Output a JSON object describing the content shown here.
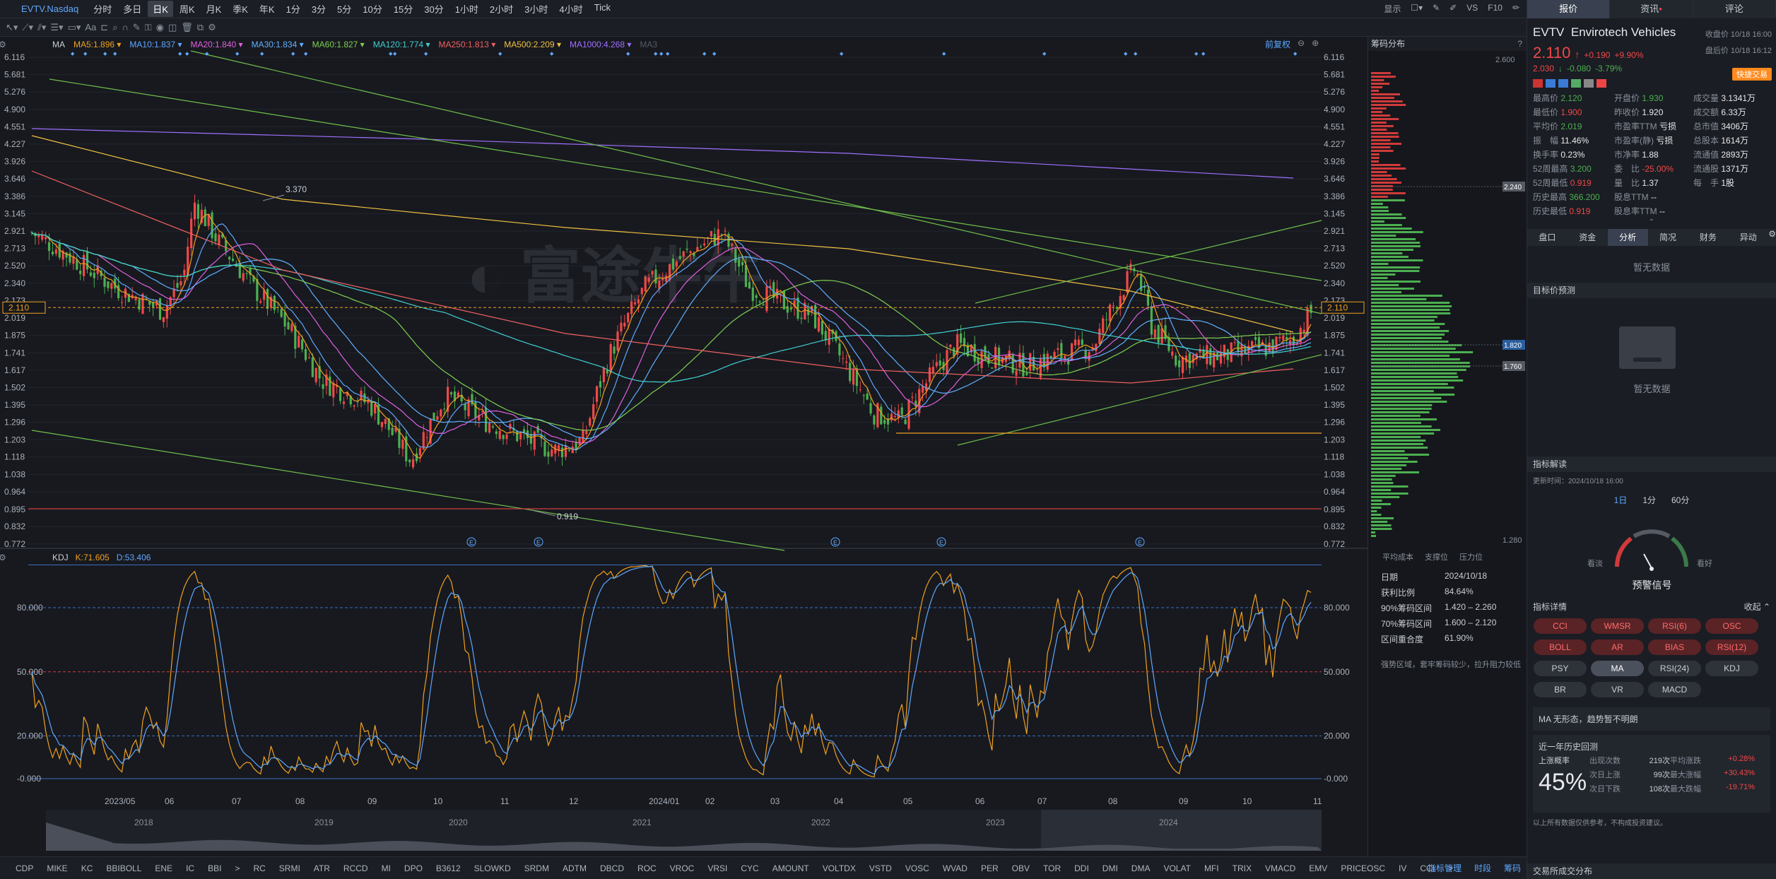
{
  "toolbar": {
    "symbol": "EVTV.Nasdaq",
    "timeframes": [
      "分时",
      "多日",
      "日K",
      "周K",
      "月K",
      "季K",
      "年K",
      "1分",
      "3分",
      "5分",
      "10分",
      "15分",
      "30分",
      "1小时",
      "2小时",
      "3小时",
      "4小时",
      "Tick"
    ],
    "active_timeframe": "日K",
    "right_items": [
      "显示",
      "VS",
      "F10"
    ]
  },
  "ma_legend": {
    "name": "MA",
    "items": [
      {
        "label": "MA5:1.896",
        "color": "#f0a020"
      },
      {
        "label": "MA10:1.837",
        "color": "#5fa8ff"
      },
      {
        "label": "MA20:1.840",
        "color": "#e060e0"
      },
      {
        "label": "MA30:1.834",
        "color": "#60b0ff"
      },
      {
        "label": "MA60:1.827",
        "color": "#7fd050"
      },
      {
        "label": "MA120:1.774",
        "color": "#40d0d0"
      },
      {
        "label": "MA250:1.813",
        "color": "#f06060"
      },
      {
        "label": "MA500:2.209",
        "color": "#f0c040"
      },
      {
        "label": "MA1000:4.268",
        "color": "#a070ff"
      },
      {
        "label": "MA3",
        "color": "#555a63"
      }
    ],
    "adjust": "前复权"
  },
  "kdj_legend": {
    "name": "KDJ",
    "k": "K:71.605",
    "d": "D:53.406"
  },
  "price_axis": [
    "6.116",
    "5.681",
    "5.276",
    "4.900",
    "4.551",
    "4.227",
    "3.926",
    "3.646",
    "3.386",
    "3.145",
    "2.921",
    "2.713",
    "2.520",
    "2.340",
    "2.173",
    "2.019",
    "1.875",
    "1.741",
    "1.617",
    "1.502",
    "1.395",
    "1.296",
    "1.203",
    "1.118",
    "1.038",
    "0.964",
    "0.895",
    "0.832",
    "0.772"
  ],
  "current_price_tag": "2.110",
  "high_label": "3.370",
  "low_label": "0.919",
  "kdj_axis": [
    "80.000",
    "50.000",
    "20.000",
    "-0.000"
  ],
  "time_axis": [
    "2023/05",
    "06",
    "07",
    "08",
    "09",
    "10",
    "11",
    "12",
    "2024/01",
    "02",
    "03",
    "04",
    "05",
    "06",
    "07",
    "08",
    "09",
    "10",
    "11"
  ],
  "overview_years": [
    "2018",
    "2019",
    "2020",
    "2021",
    "2022",
    "2023",
    "2024"
  ],
  "chips": {
    "title": "筹码分布",
    "top_value": "2.600",
    "bottom_value": "1.280",
    "marker1": "2.240",
    "marker2": "1.820",
    "marker3": "1.760",
    "legend": [
      "平均成本",
      "支撑位",
      "压力位"
    ],
    "rows": [
      {
        "label": "日期",
        "value": "2024/10/18"
      },
      {
        "label": "获利比例",
        "value": "84.64%"
      },
      {
        "label": "90%筹码区间",
        "value": "1.420 – 2.260"
      },
      {
        "label": "70%筹码区间",
        "value": "1.600 – 2.120"
      },
      {
        "label": "区间重合度",
        "value": "61.90%"
      }
    ],
    "note": "强势区域，套牢筹码较少，拉升阻力较低"
  },
  "right_panel": {
    "tabs": [
      "报价",
      "资讯",
      "评论"
    ],
    "ticker": "EVTV",
    "company": "Envirotech Vehicles",
    "price": "2.110",
    "change": "+0.190",
    "change_pct": "+9.90%",
    "close_label": "收盘价 10/18 16:00",
    "after_price": "2.030",
    "after_change": "-0.080",
    "after_pct": "-3.79%",
    "after_label": "盘后价 10/18 16:12",
    "quick_trade": "快捷交易",
    "stats": [
      [
        "最高价",
        "2.120",
        "开盘价",
        "1.930",
        "成交量",
        "3.1341万"
      ],
      [
        "最低价",
        "1.900",
        "昨收价",
        "1.920",
        "成交额",
        "6.33万"
      ],
      [
        "平均价",
        "2.019",
        "市盈率TTM",
        "亏损",
        "总市值",
        "3406万"
      ],
      [
        "振　幅",
        "11.46%",
        "市盈率(静)",
        "亏损",
        "总股本",
        "1614万"
      ],
      [
        "换手率",
        "0.23%",
        "市净率",
        "1.88",
        "流通值",
        "2893万"
      ],
      [
        "52周最高",
        "3.200",
        "委　比",
        "-25.00%",
        "流通股",
        "1371万"
      ],
      [
        "52周最低",
        "0.919",
        "量　比",
        "1.37",
        "每　手",
        "1股"
      ],
      [
        "历史最高",
        "366.200",
        "股息TTM",
        "--",
        "",
        ""
      ],
      [
        "历史最低",
        "0.919",
        "股息率TTM",
        "--",
        "",
        ""
      ]
    ],
    "subtabs": [
      "盘口",
      "资金",
      "分析",
      "简况",
      "财务",
      "异动"
    ],
    "no_data": "暂无数据",
    "target_title": "目标价预测",
    "indicator_title": "指标解读",
    "update_time": "更新时间：2024/10/18 16:00",
    "periods": [
      "1日",
      "1分",
      "60分"
    ],
    "gauge_left": "看淡",
    "gauge_right": "看好",
    "gauge_label": "预警信号",
    "detail_title": "指标详情",
    "collapse": "收起",
    "chips_ind": [
      {
        "t": "CCI",
        "c": "r"
      },
      {
        "t": "WMSR",
        "c": "r"
      },
      {
        "t": "RSI(6)",
        "c": "r"
      },
      {
        "t": "OSC",
        "c": "r"
      },
      {
        "t": "BOLL",
        "c": "r"
      },
      {
        "t": "AR",
        "c": "r"
      },
      {
        "t": "BIAS",
        "c": "r"
      },
      {
        "t": "RSI(12)",
        "c": "r"
      },
      {
        "t": "PSY",
        "c": "g"
      },
      {
        "t": "MA",
        "c": "sel"
      },
      {
        "t": "RSI(24)",
        "c": "g"
      },
      {
        "t": "KDJ",
        "c": "g"
      },
      {
        "t": "BR",
        "c": "g"
      },
      {
        "t": "VR",
        "c": "g"
      },
      {
        "t": "MACD",
        "c": "g"
      }
    ],
    "ma_text": "MA 无形态，趋势暂不明朗",
    "history_title": "近一年历史回测",
    "prob_label": "上涨概率",
    "prob_value": "45%",
    "hist_rows": [
      [
        "出现次数",
        "219次",
        "平均涨跌",
        "+0.28%"
      ],
      [
        "次日上涨",
        "99次",
        "最大涨幅",
        "+30.43%"
      ],
      [
        "次日下跌",
        "108次",
        "最大跌幅",
        "-19.71%"
      ]
    ],
    "disclaimer": "以上所有数据仅供参考，不构成投资建议。",
    "footer_title": "交易所成交分布"
  },
  "bottom_indicators": [
    "CDP",
    "MIKE",
    "KC",
    "BBIBOLL",
    "ENE",
    "IC",
    "BBI",
    ">",
    "RC",
    "SRMI",
    "ATR",
    "RCCD",
    "MI",
    "DPO",
    "B3612",
    "SLOWKD",
    "SRDM",
    "ADTM",
    "DBCD",
    "ROC",
    "VROC",
    "VRSI",
    "CYC",
    "AMOUNT",
    "VOLTDX",
    "VSTD",
    "VOSC",
    "WVAD",
    "PER",
    "OBV",
    "TOR",
    "DDI",
    "DMI",
    "DMA",
    "VOLAT",
    "MFI",
    "TRIX",
    "VMACD",
    "EMV",
    "PRICEOSC",
    "IV",
    "CCI",
    ">"
  ],
  "bottom_right": [
    "指标管理",
    "时段",
    "筹码"
  ],
  "colors": {
    "up": "#f04848",
    "down": "#4caf50",
    "accent": "#5fa8ff",
    "orange": "#ff9d2e"
  }
}
